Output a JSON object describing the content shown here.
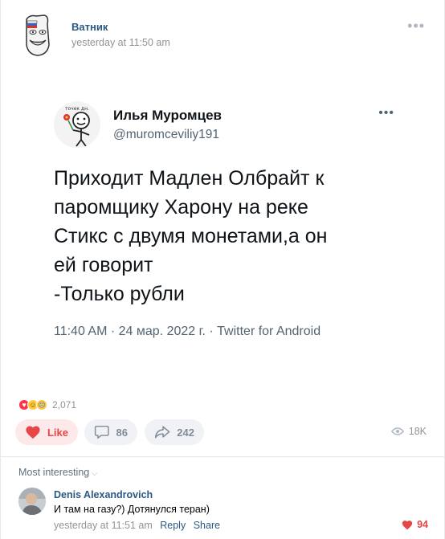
{
  "post": {
    "group_name": "Ватник",
    "time": "yesterday at 11:50 am",
    "more_icon": "ellipsis-icon"
  },
  "tweet": {
    "name": "Илья Муромцев",
    "handle": "@muromceviliy191",
    "avatar_caption": "точек дн.",
    "text": "Приходит Мадлен Олбрайт к\nпаромщику Харону на реке\nСтикс с двумя монетами,а он\nей говорит\n-Только рубли",
    "meta": "11:40 AM · 24 мар. 2022 г. · Twitter for Android"
  },
  "reactions": {
    "icons": [
      "heart-reaction-icon",
      "laugh-reaction-icon",
      "sad-reaction-icon"
    ],
    "count": "2,071"
  },
  "actions": {
    "like_label": "Like",
    "comments_count": "86",
    "shares_count": "242",
    "views_count": "18K"
  },
  "comments": {
    "sort_label": "Most interesting",
    "items": [
      {
        "author": "Denis Alexandrovich",
        "text": "И там на газу?) Дотянулся теран)",
        "time": "yesterday at 11:51 am",
        "reply_label": "Reply",
        "share_label": "Share",
        "likes": "94"
      }
    ]
  },
  "colors": {
    "link": "#2a5885",
    "like_red": "#e64646",
    "muted": "#939393"
  }
}
